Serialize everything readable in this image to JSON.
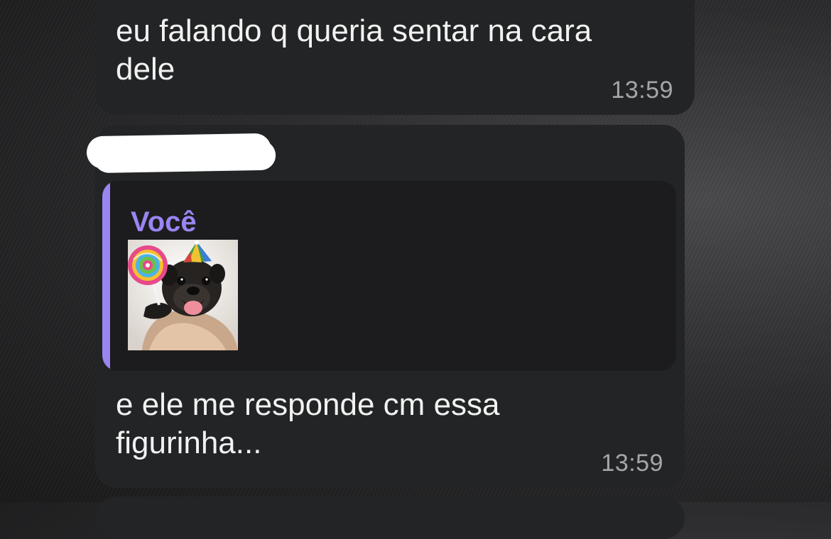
{
  "chat": {
    "messages": [
      {
        "text": "eu falando q queria sentar na cara\ndele",
        "time": "13:59"
      },
      {
        "quote": {
          "author": "Você",
          "sticker": "pug-with-party-hat-and-lollipop-sticker"
        },
        "text": "e ele me responde cm essa\nfigurinha...",
        "time": "13:59"
      }
    ]
  },
  "colors": {
    "bubble": "#232425",
    "quote_accent": "#9a85f2",
    "timestamp": "#a5a6a8",
    "text": "#f2f2f2"
  }
}
